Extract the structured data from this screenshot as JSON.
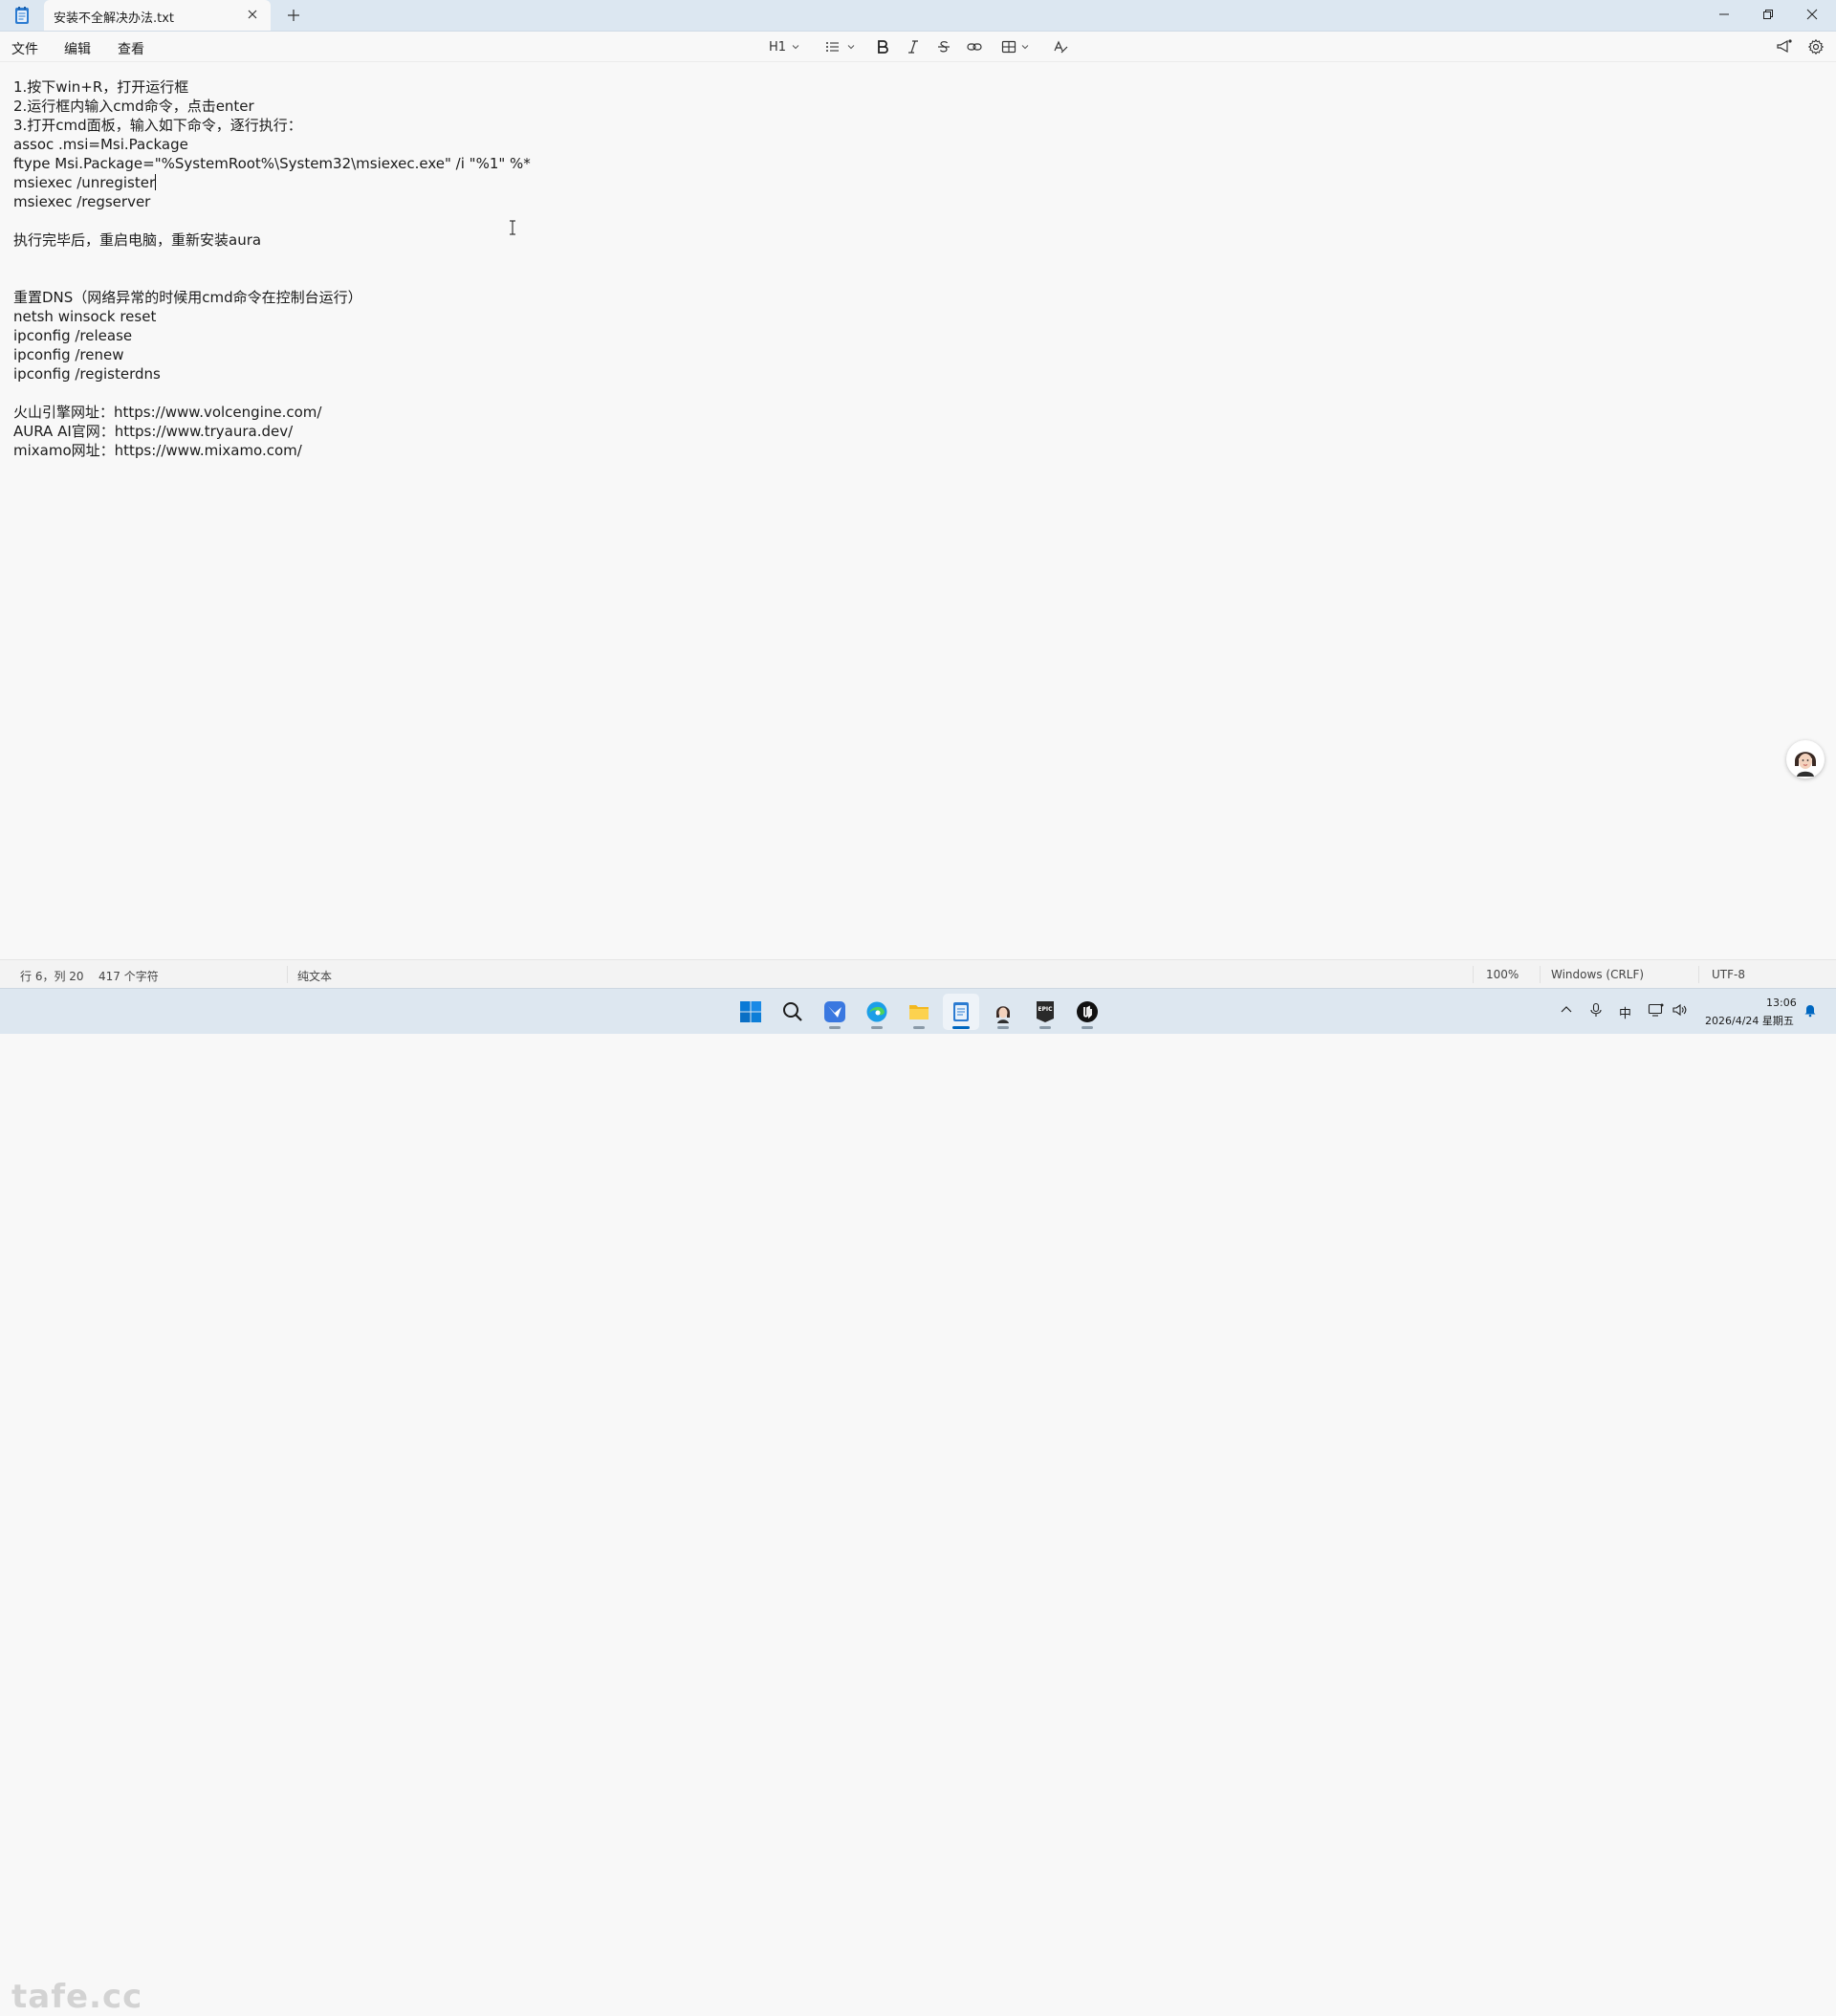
{
  "window": {
    "tab_title": "安装不全解决办法.txt",
    "colors": {
      "titlebar": "#dce7f1",
      "background": "#f8f8f8",
      "accent": "#0067c0"
    }
  },
  "menu": {
    "file": "文件",
    "edit": "编辑",
    "view": "查看"
  },
  "toolbar": {
    "heading": "H1"
  },
  "editor": {
    "lines": [
      "1.按下win+R，打开运行框",
      "2.运行框内输入cmd命令，点击enter",
      "3.打开cmd面板，输入如下命令，逐行执行：",
      "assoc .msi=Msi.Package",
      "ftype Msi.Package=\"%SystemRoot%\\System32\\msiexec.exe\" /i \"%1\" %*",
      "msiexec /unregister",
      "msiexec /regserver",
      "",
      "执行完毕后，重启电脑，重新安装aura",
      "",
      "",
      "重置DNS（网络异常的时候用cmd命令在控制台运行）",
      "netsh winsock reset",
      "ipconfig /release",
      "ipconfig /renew",
      "ipconfig /registerdns",
      "",
      "火山引擎网址：https://www.volcengine.com/",
      "AURA AI官网：https://www.tryaura.dev/",
      "mixamo网址：https://www.mixamo.com/"
    ]
  },
  "status": {
    "position": "行 6，列 20",
    "char_count": "417 个字符",
    "format": "纯文本",
    "zoom": "100%",
    "line_ending": "Windows (CRLF)",
    "encoding": "UTF-8"
  },
  "taskbar": {
    "ime": "中",
    "time": "13:06",
    "date": "2026/4/24 星期五",
    "epic_label": "EPIC"
  },
  "watermark": "tafe.cc"
}
